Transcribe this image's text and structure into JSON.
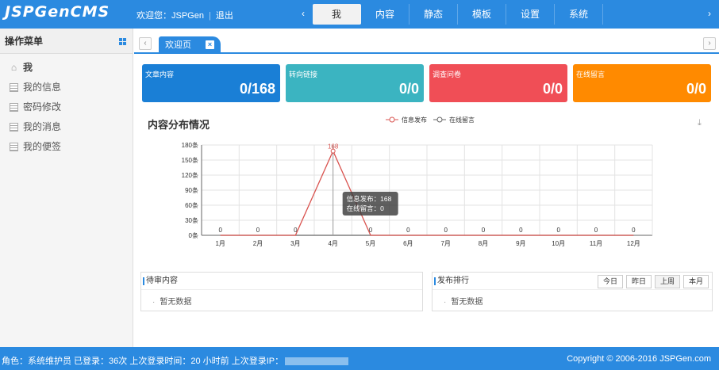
{
  "header": {
    "logo": "JSPGenCMS",
    "welcome": "欢迎您：JSPGen",
    "logout": "退出",
    "prev": "‹",
    "next": "›",
    "nav": [
      "我",
      "内容",
      "静态",
      "模板",
      "设置",
      "系统"
    ]
  },
  "sidebar": {
    "title": "操作菜单",
    "items": [
      "我",
      "我的信息",
      "密码修改",
      "我的消息",
      "我的便签"
    ]
  },
  "tabs": {
    "prev": "‹",
    "next": "›",
    "active": "欢迎页",
    "close": "×"
  },
  "cards": [
    {
      "label": "文章内容",
      "value": "0/168",
      "color": "#1a7fd6"
    },
    {
      "label": "转向链接",
      "value": "0/0",
      "color": "#3bb4c1"
    },
    {
      "label": "调查问卷",
      "value": "0/0",
      "color": "#f04e56"
    },
    {
      "label": "在线留言",
      "value": "0/0",
      "color": "#ff8a00"
    }
  ],
  "chart_title": "内容分布情况",
  "chart_data": {
    "type": "line",
    "title": "内容分布情况",
    "categories": [
      "1月",
      "2月",
      "3月",
      "4月",
      "5月",
      "6月",
      "7月",
      "8月",
      "9月",
      "10月",
      "11月",
      "12月"
    ],
    "series": [
      {
        "name": "信息发布",
        "values": [
          0,
          0,
          0,
          168,
          0,
          0,
          0,
          0,
          0,
          0,
          0,
          0
        ],
        "color": "#d9534f"
      },
      {
        "name": "在线留言",
        "values": [
          0,
          0,
          0,
          0,
          0,
          0,
          0,
          0,
          0,
          0,
          0,
          0
        ],
        "color": "#666666"
      }
    ],
    "yticks": [
      "0条",
      "30条",
      "60条",
      "90条",
      "120条",
      "150条",
      "180条"
    ],
    "ylim": [
      0,
      180
    ],
    "grid": true,
    "legend": "top-center",
    "tooltip": {
      "lines": [
        "信息发布：168",
        "在线留言：0"
      ]
    }
  },
  "panels": {
    "pending_title": "待审内容",
    "pending_empty": "暂无数据",
    "rank_title": "发布排行",
    "rank_empty": "暂无数据",
    "ranges": [
      "今日",
      "昨日",
      "上周",
      "本月"
    ]
  },
  "footer": {
    "info": "角色：系统维护员  已登录：36次  上次登录时间：20 小时前  上次登录IP：",
    "copyright": "Copyright © 2006-2016 JSPGen.com"
  }
}
